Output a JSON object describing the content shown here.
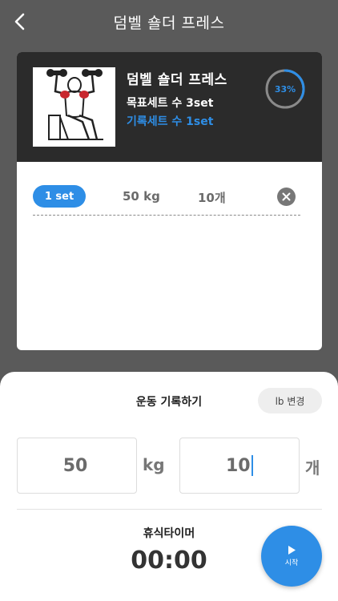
{
  "header": {
    "title": "덤벨 숄더 프레스"
  },
  "exercise": {
    "name": "덤벨 숄더 프레스",
    "goal_sets": "목표세트 수 3set",
    "recorded_sets": "기록세트 수 1set",
    "progress_text": "33%",
    "progress_fraction": 0.33
  },
  "sets": [
    {
      "label": "1 set",
      "weight": "50 kg",
      "reps": "10개"
    }
  ],
  "record": {
    "title": "운동 기록하기",
    "unit_button": "lb 변경",
    "weight_value": "50",
    "weight_unit": "kg",
    "reps_value": "10",
    "reps_unit": "개"
  },
  "timer": {
    "label": "휴식타이머",
    "value": "00:00",
    "start_label": "시작"
  },
  "colors": {
    "accent": "#2e8ee6",
    "header_bg": "#5a5a5a",
    "card_top_bg": "#2b2b2b"
  },
  "icons": {
    "back": "chevron-left-icon",
    "delete": "close-icon",
    "play": "play-icon"
  }
}
